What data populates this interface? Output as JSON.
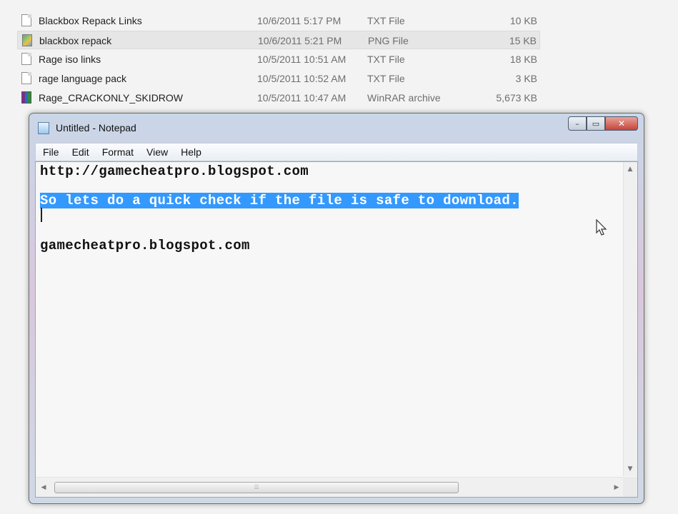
{
  "explorer": {
    "files": [
      {
        "name": "Blackbox Repack Links",
        "date": "10/6/2011 5:17 PM",
        "type": "TXT File",
        "size": "10 KB",
        "icon": "text-file-icon"
      },
      {
        "name": "blackbox repack",
        "date": "10/6/2011 5:21 PM",
        "type": "PNG File",
        "size": "15 KB",
        "icon": "png-file-icon"
      },
      {
        "name": "Rage iso links",
        "date": "10/5/2011 10:51 AM",
        "type": "TXT File",
        "size": "18 KB",
        "icon": "text-file-icon"
      },
      {
        "name": "rage language pack",
        "date": "10/5/2011 10:52 AM",
        "type": "TXT File",
        "size": "3 KB",
        "icon": "text-file-icon"
      },
      {
        "name": "Rage_CRACKONLY_SKIDROW",
        "date": "10/5/2011 10:47 AM",
        "type": "WinRAR archive",
        "size": "5,673 KB",
        "icon": "winrar-archive-icon"
      }
    ],
    "selected_index": 1
  },
  "notepad": {
    "title": "Untitled - Notepad",
    "menu": [
      "File",
      "Edit",
      "Format",
      "View",
      "Help"
    ],
    "lines": [
      "http://gamecheatpro.blogspot.com",
      "",
      "So lets do a quick check if the file is safe to download.",
      "",
      "",
      "gamecheatpro.blogspot.com"
    ],
    "selected_line_index": 2,
    "controls": {
      "minimize": "–",
      "maximize": "▭",
      "close": "✕"
    },
    "scroll": {
      "up": "▲",
      "down": "▼",
      "left": "◀",
      "right": "▶",
      "grip": "⦙⦙⦙"
    }
  },
  "colors": {
    "selection": "#3399ff",
    "editor_bg": "#f7f7f7",
    "close_button": "#c6443a"
  }
}
